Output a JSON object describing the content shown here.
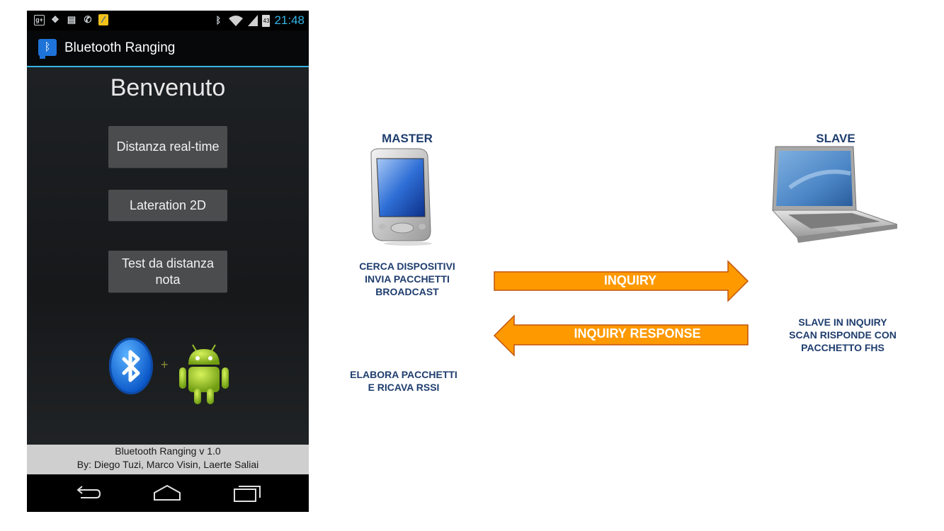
{
  "status_bar": {
    "left_icons": [
      "google-plus-icon",
      "dropbox-icon",
      "chat-icon",
      "whatsapp-icon",
      "notification-icon"
    ],
    "battery": "43",
    "time": "21:48"
  },
  "app": {
    "title": "Bluetooth Ranging"
  },
  "main": {
    "welcome": "Benvenuto",
    "buttons": [
      {
        "label": "Distanza real-time"
      },
      {
        "label": "Lateration 2D"
      },
      {
        "label": "Test da distanza nota"
      }
    ]
  },
  "footer": {
    "line1": "Bluetooth Ranging v 1.0",
    "line2": "By: Diego Tuzi, Marco Visin, Laerte Saliai"
  },
  "navbar": {
    "icons": [
      "back-icon",
      "home-icon",
      "recent-apps-icon"
    ]
  },
  "diagram": {
    "master_label": "MASTER",
    "slave_label": "SLAVE",
    "master_text1": [
      "CERCA DISPOSITIVI",
      "INVIA PACCHETTI",
      "BROADCAST"
    ],
    "master_text2": [
      "ELABORA PACCHETTI",
      "E RICAVA RSSI"
    ],
    "slave_text": [
      "SLAVE IN INQUIRY",
      "SCAN RISPONDE CON",
      "PACCHETTO FHS"
    ],
    "arrow_right": "INQUIRY",
    "arrow_left": "INQUIRY RESPONSE",
    "colors": {
      "arrow_fill": "#ff9900",
      "arrow_stroke": "#c0540b",
      "text": "#1f3d6e"
    }
  }
}
